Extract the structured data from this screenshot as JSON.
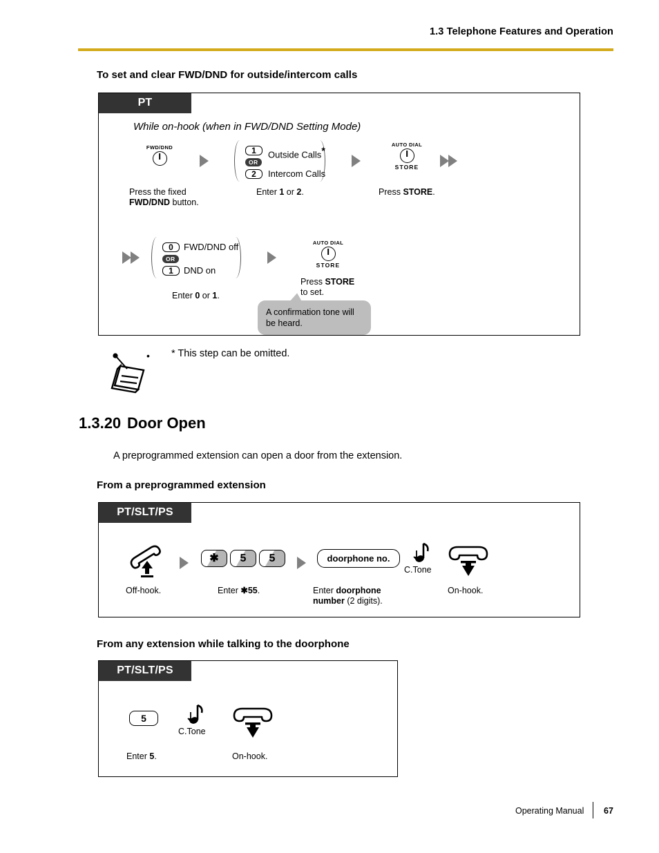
{
  "header": {
    "title": "1.3 Telephone Features and Operation",
    "rule_color": "#d4aa1c"
  },
  "fwd_dnd_section": {
    "heading": "To set and clear FWD/DND for outside/intercom calls",
    "box": {
      "tag": "PT",
      "subtitle": "While on-hook (when in FWD/DND Setting Mode)",
      "row1": {
        "step1": {
          "icon": "fixed-button-icon",
          "icon_top_label": "FWD/DND",
          "caption_line1": "Press the fixed",
          "caption_line2_bold": "FWD/DND",
          "caption_line2_rest": " button."
        },
        "step2": {
          "option_a_key": "1",
          "option_a_label": "Outside Calls",
          "option_a_asterisk": "*",
          "or_label": "OR",
          "option_b_key": "2",
          "option_b_label": "Intercom Calls",
          "caption_prefix": "Enter ",
          "caption_key_a": "1",
          "caption_mid": " or ",
          "caption_key_b": "2",
          "caption_suffix": "."
        },
        "step3": {
          "icon": "auto-dial-store-icon",
          "icon_top_label": "AUTO DIAL",
          "icon_bottom_label": "STORE",
          "caption_prefix": "Press ",
          "caption_bold": "STORE",
          "caption_suffix": "."
        }
      },
      "row2": {
        "step4": {
          "option_a_key": "0",
          "option_a_label": "FWD/DND off",
          "or_label": "OR",
          "option_b_key": "1",
          "option_b_label": "DND on",
          "caption_prefix": "Enter ",
          "caption_key_a": "0",
          "caption_mid": " or ",
          "caption_key_b": "1",
          "caption_suffix": "."
        },
        "step5": {
          "icon": "auto-dial-store-icon",
          "icon_top_label": "AUTO DIAL",
          "icon_bottom_label": "STORE",
          "caption_prefix": "Press ",
          "caption_bold": "STORE",
          "caption_line2": "to set."
        },
        "bubble": {
          "line1": "A confirmation tone will",
          "line2": "be heard.",
          "color": "#bdbdbd"
        }
      }
    },
    "note": {
      "icon": "notepad-pen-icon",
      "bullet": "•",
      "text": "* This step can be omitted."
    }
  },
  "door_open_section": {
    "number": "1.3.20",
    "title": "Door Open",
    "description": "A preprogrammed extension can open a door from the extension.",
    "sub1": {
      "heading": "From a preprogrammed extension",
      "box": {
        "tag": "PT/SLT/PS",
        "step1": {
          "icon": "offhook-handset-icon",
          "caption": "Off-hook."
        },
        "step2": {
          "keys": [
            "✱",
            "5",
            "5"
          ],
          "caption_prefix": "Enter ",
          "caption_bold": "✱55",
          "caption_suffix": "."
        },
        "step3": {
          "pill_label": "doorphone no.",
          "caption_line1_prefix": "Enter ",
          "caption_line1_bold": "doorphone",
          "caption_line2_bold": "number",
          "caption_line2_rest": " (2 digits)."
        },
        "step4": {
          "icon": "tone-note-icon",
          "tone_label": "C.Tone"
        },
        "step5": {
          "icon": "onhook-handset-icon",
          "caption": "On-hook."
        }
      }
    },
    "sub2": {
      "heading": "From any extension while talking to the doorphone",
      "box": {
        "tag": "PT/SLT/PS",
        "step1": {
          "key": "5",
          "caption_prefix": "Enter ",
          "caption_bold": "5",
          "caption_suffix": "."
        },
        "step2": {
          "icon": "tone-note-icon",
          "tone_label": "C.Tone"
        },
        "step3": {
          "icon": "onhook-handset-icon",
          "caption": "On-hook."
        }
      }
    }
  },
  "footer": {
    "manual": "Operating Manual",
    "page": "67"
  }
}
